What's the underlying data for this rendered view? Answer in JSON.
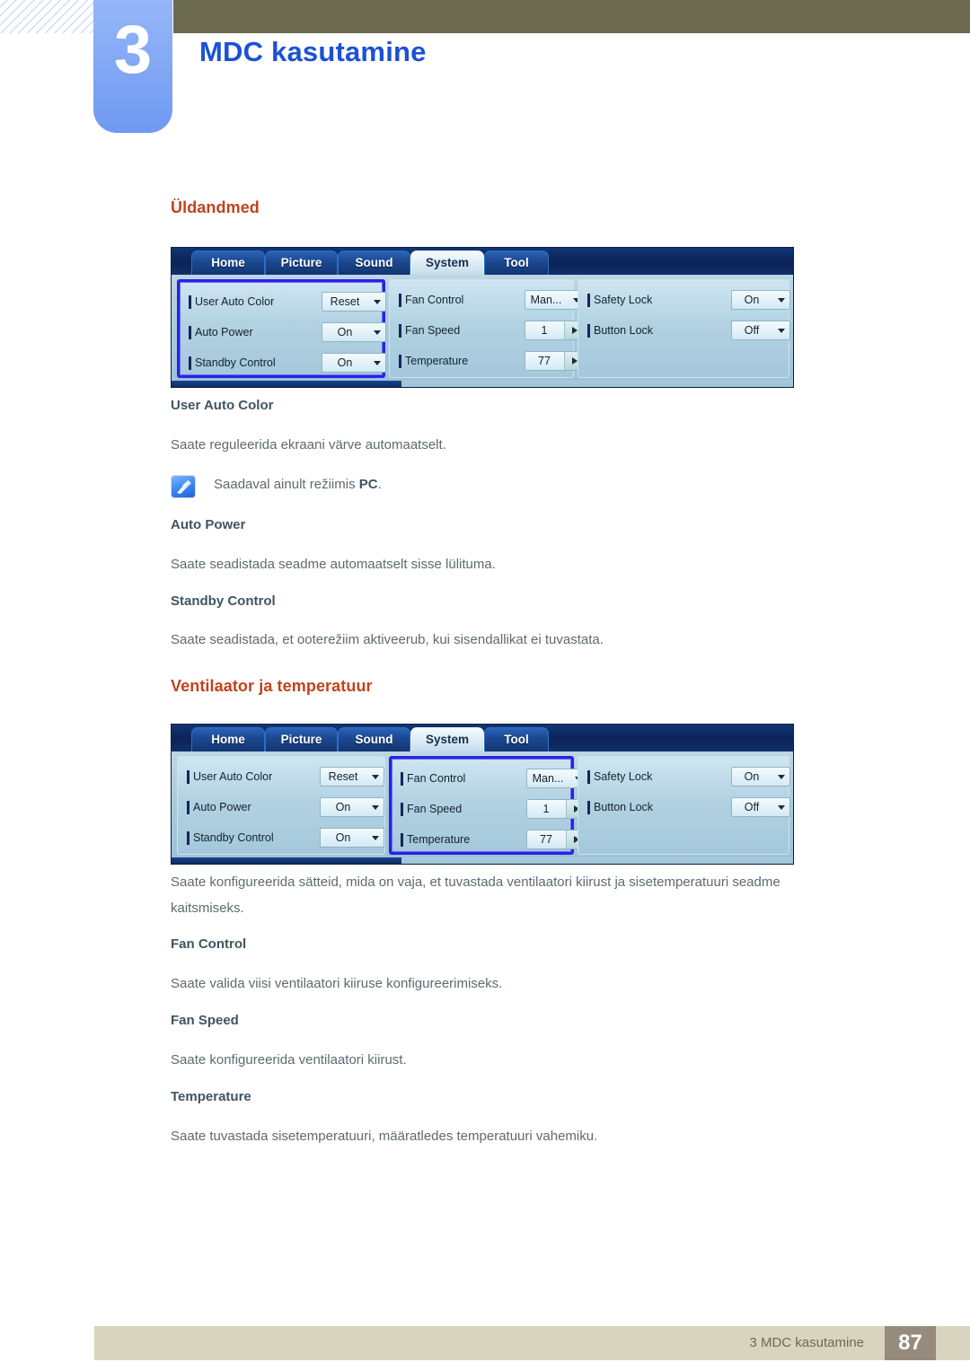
{
  "header": {
    "chapter_number": "3",
    "chapter_title": "MDC kasutamine"
  },
  "sections": {
    "general": {
      "heading": "Üldandmed",
      "sub1": "User Auto Color",
      "p1": "Saate reguleerida ekraani värve automaatselt.",
      "note_icon": "note-pencil-icon",
      "note_prefix": "Saadaval ainult režiimis ",
      "note_bold": "PC",
      "note_suffix": ".",
      "sub2": "Auto Power",
      "p2": "Saate seadistada seadme automaatselt sisse lülituma.",
      "sub3": "Standby Control",
      "p3": "Saate seadistada, et ooterežiim aktiveerub, kui sisendallikat ei tuvastata."
    },
    "fan": {
      "heading": "Ventilaator ja temperatuur",
      "p_intro_line1": "Saate konfigureerida sätteid, mida on vaja, et tuvastada ventilaatori kiirust ja sisetemperatuuri seadme",
      "p_intro_line2": "kaitsmiseks.",
      "sub1": "Fan Control",
      "p1": "Saate valida viisi ventilaatori kiiruse konfigureerimiseks.",
      "sub2": "Fan Speed",
      "p2": "Saate konfigureerida ventilaatori kiirust.",
      "sub3": "Temperature",
      "p3": "Saate tuvastada sisetemperatuuri, määratledes temperatuuri vahemiku."
    }
  },
  "mdc_window": {
    "tabs": [
      {
        "label": "Home",
        "active": false
      },
      {
        "label": "Picture",
        "active": false
      },
      {
        "label": "Sound",
        "active": false
      },
      {
        "label": "System",
        "active": true
      },
      {
        "label": "Tool",
        "active": false
      }
    ],
    "panels": [
      {
        "id": "general-panel",
        "rows": [
          {
            "label": "User Auto Color",
            "value": "Reset",
            "control": "dropdown"
          },
          {
            "label": "Auto Power",
            "value": "On",
            "control": "dropdown"
          },
          {
            "label": "Standby Control",
            "value": "On",
            "control": "dropdown"
          }
        ]
      },
      {
        "id": "fan-panel",
        "rows": [
          {
            "label": "Fan Control",
            "value": "Man...",
            "control": "dropdown"
          },
          {
            "label": "Fan Speed",
            "value": "1",
            "control": "spinner"
          },
          {
            "label": "Temperature",
            "value": "77",
            "control": "spinner"
          }
        ]
      },
      {
        "id": "lock-panel",
        "rows": [
          {
            "label": "Safety Lock",
            "value": "On",
            "control": "dropdown"
          },
          {
            "label": "Button Lock",
            "value": "Off",
            "control": "dropdown"
          }
        ]
      }
    ],
    "selected_panel_first": "general-panel",
    "selected_panel_second": "fan-panel"
  },
  "footer": {
    "text": "3 MDC kasutamine",
    "page": "87"
  },
  "colors": {
    "chapter_title": "#1b51d6",
    "section_heading": "#c0441c",
    "subheading": "#3f5560",
    "body": "#5e6a70",
    "olive": "#6d6a52",
    "footer_bar": "#d8d4c0",
    "footer_page": "#968b7c",
    "selection": "#2822e8"
  }
}
